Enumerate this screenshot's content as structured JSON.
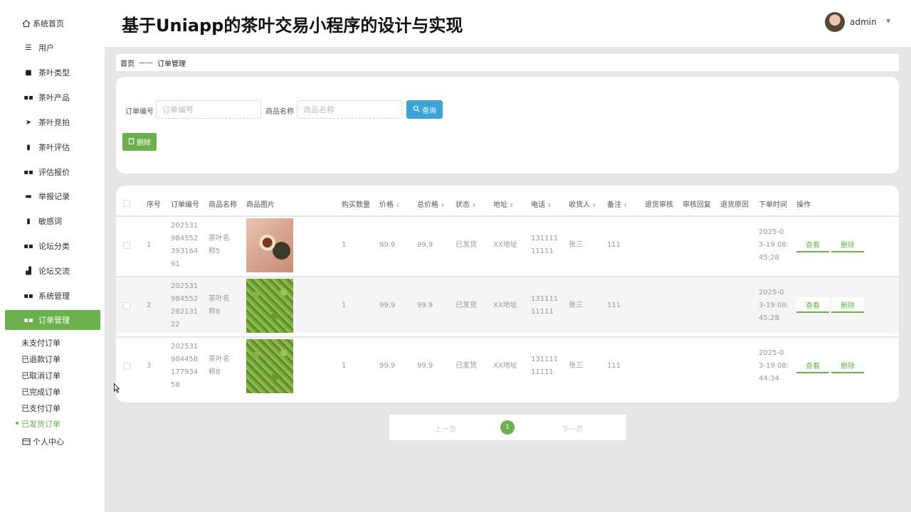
{
  "app_title": "基于Uniapp的茶叶交易小程序的设计与实现",
  "user": {
    "name": "admin"
  },
  "sidebar": {
    "home": "系统首页",
    "items": [
      {
        "label": "用户",
        "icon": "list-icon"
      },
      {
        "label": "茶叶类型",
        "icon": "briefcase-icon"
      },
      {
        "label": "茶叶产品",
        "icon": "grid-icon"
      },
      {
        "label": "茶叶竞拍",
        "icon": "send-icon"
      },
      {
        "label": "茶叶评估",
        "icon": "clipboard-icon"
      },
      {
        "label": "评估报价",
        "icon": "grid-icon"
      },
      {
        "label": "举报记录",
        "icon": "ticket-icon"
      },
      {
        "label": "敏感词",
        "icon": "book-icon"
      },
      {
        "label": "论坛分类",
        "icon": "grid-icon"
      },
      {
        "label": "论坛交流",
        "icon": "thumb-icon"
      },
      {
        "label": "系统管理",
        "icon": "grid-icon"
      },
      {
        "label": "订单管理",
        "icon": "grid-icon"
      }
    ],
    "sub_items": [
      "未支付订单",
      "已退款订单",
      "已取消订单",
      "已完成订单",
      "已支付订单",
      "已发货订单"
    ],
    "personal": "个人中心"
  },
  "breadcrumb": {
    "home": "首页",
    "sep": "——",
    "current": "订单管理"
  },
  "search": {
    "order_no_label": "订单编号",
    "order_no_placeholder": "订单编号",
    "goods_name_label": "商品名称",
    "goods_name_placeholder": "商品名称",
    "query_label": "查询",
    "delete_label": "删除"
  },
  "table": {
    "headers": [
      "序号",
      "订单编号",
      "商品名称",
      "商品图片",
      "购买数量",
      "价格",
      "总价格",
      "状态",
      "地址",
      "电话",
      "收货人",
      "备注",
      "退货审核",
      "审核回复",
      "退货原因",
      "下单时间",
      "操作"
    ],
    "rows": [
      {
        "index": "1",
        "order_no": [
          "202531",
          "984552",
          "393164",
          "91"
        ],
        "goods": [
          "茶叶名",
          "称5"
        ],
        "image": "tea-cup",
        "qty": "1",
        "price": "99.9",
        "total": "99.9",
        "status": "已发货",
        "address": "XX地址",
        "phone": [
          "131111",
          "11111"
        ],
        "receiver": "张三",
        "remark": "111",
        "time": [
          "2025-0",
          "3-19 08:",
          "45:28"
        ]
      },
      {
        "index": "2",
        "order_no": [
          "202531",
          "984552",
          "282131",
          "22"
        ],
        "goods": [
          "茶叶名",
          "称8"
        ],
        "image": "tea-leaf",
        "qty": "1",
        "price": "99.9",
        "total": "99.9",
        "status": "已发货",
        "address": "XX地址",
        "phone": [
          "131111",
          "11111"
        ],
        "receiver": "张三",
        "remark": "111",
        "time": [
          "2025-0",
          "3-19 08:",
          "45:28"
        ]
      },
      {
        "index": "3",
        "order_no": [
          "202531",
          "984458",
          "177934",
          "58"
        ],
        "goods": [
          "茶叶名",
          "称8"
        ],
        "image": "tea-leaf",
        "qty": "1",
        "price": "99.9",
        "total": "99.9",
        "status": "已发货",
        "address": "XX地址",
        "phone": [
          "131111",
          "11111"
        ],
        "receiver": "张三",
        "remark": "111",
        "time": [
          "2025-0",
          "3-19 08:",
          "44:34"
        ]
      }
    ],
    "view_label": "查看",
    "delete_label": "删除"
  },
  "pagination": {
    "prev": "上一页",
    "current": "1",
    "next": "下一页"
  },
  "colors": {
    "accent": "#6ab04c",
    "query": "#3aa3d8"
  }
}
